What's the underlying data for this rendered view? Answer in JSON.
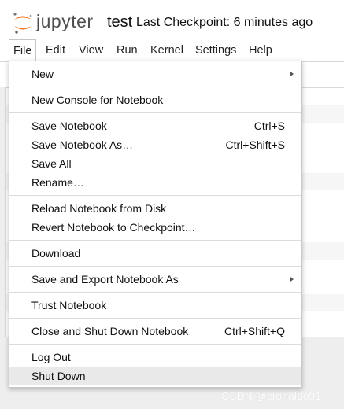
{
  "header": {
    "brand": "jupyter",
    "notebook_name": "test",
    "checkpoint": "Last Checkpoint: 6 minutes ago",
    "logo_icon": "jupyter-logo-icon",
    "logo_color": "#f37726"
  },
  "menubar": {
    "items": [
      "File",
      "Edit",
      "View",
      "Run",
      "Kernel",
      "Settings",
      "Help"
    ],
    "active": "File"
  },
  "file_menu": {
    "new": "New",
    "new_console": "New Console for Notebook",
    "save": "Save Notebook",
    "save_shortcut": "Ctrl+S",
    "save_as": "Save Notebook As…",
    "save_as_shortcut": "Ctrl+Shift+S",
    "save_all": "Save All",
    "rename": "Rename…",
    "reload": "Reload Notebook from Disk",
    "revert": "Revert Notebook to Checkpoint…",
    "download": "Download",
    "save_export": "Save and Export Notebook As",
    "trust": "Trust Notebook",
    "close_shutdown": "Close and Shut Down Notebook",
    "close_shutdown_shortcut": "Ctrl+Shift+Q",
    "logout": "Log Out",
    "shutdown": "Shut Down",
    "hovered": "Shut Down"
  },
  "watermark": "CSDN @cronaldo91"
}
